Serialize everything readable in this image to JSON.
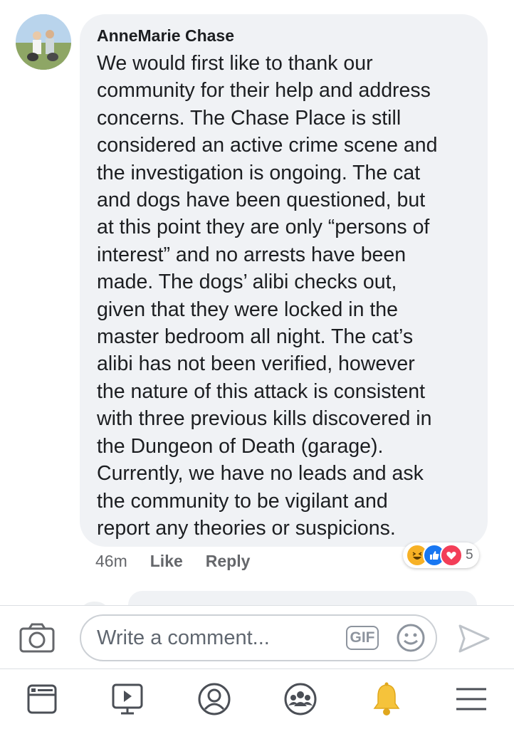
{
  "comment": {
    "author": "AnneMarie Chase",
    "lines": [
      "We would first like to thank our",
      "community for their help and address",
      "concerns. The Chase Place is still",
      "considered an active crime scene and",
      "the investigation is ongoing. The cat",
      "and dogs have been questioned, but",
      "at this point they are only “persons of",
      "interest” and no arrests have been",
      "made. The dogs’ alibi checks out,",
      "given that they were locked in the",
      "master bedroom all night. The cat’s",
      "alibi has not been verified, however",
      "the nature of this attack is consistent",
      "with three previous kills discovered in",
      "the Dungeon of Death (garage).",
      "Currently, we have no leads and ask",
      "the community to be vigilant and",
      "report any theories or suspicions."
    ],
    "time": "46m",
    "like_label": "Like",
    "reply_label": "Reply",
    "reaction_count": "5",
    "reactions": [
      "haha-icon",
      "like-icon",
      "love-icon"
    ]
  },
  "composer": {
    "placeholder": "Write a comment...",
    "gif_label": "GIF"
  },
  "tabs": [
    "news-feed-icon",
    "watch-icon",
    "profile-icon",
    "groups-icon",
    "notifications-icon",
    "menu-icon"
  ],
  "colors": {
    "facebook_blue": "#1877f2",
    "love_red": "#f33e58",
    "haha_yellow": "#f7b125",
    "bell_yellow": "#f5c33b"
  }
}
